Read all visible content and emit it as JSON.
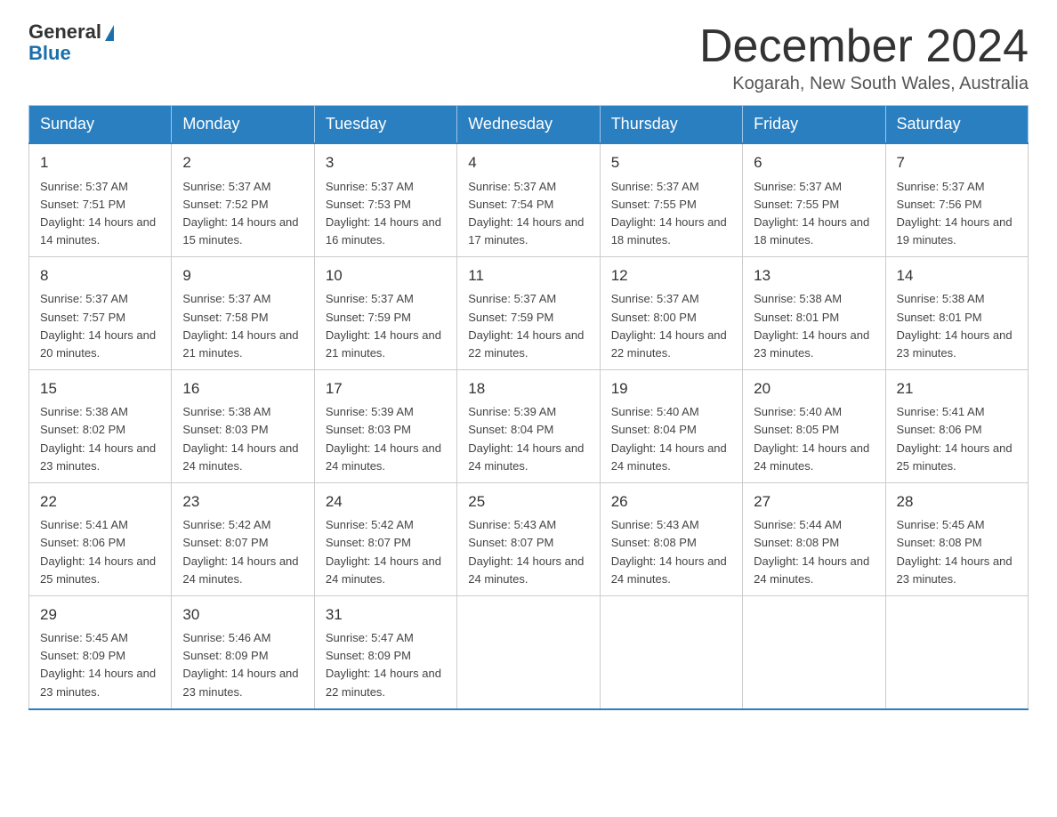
{
  "header": {
    "logo_general": "General",
    "logo_blue": "Blue",
    "month_title": "December 2024",
    "location": "Kogarah, New South Wales, Australia"
  },
  "days_of_week": [
    "Sunday",
    "Monday",
    "Tuesday",
    "Wednesday",
    "Thursday",
    "Friday",
    "Saturday"
  ],
  "weeks": [
    [
      {
        "day": "1",
        "sunrise": "5:37 AM",
        "sunset": "7:51 PM",
        "daylight": "14 hours and 14 minutes."
      },
      {
        "day": "2",
        "sunrise": "5:37 AM",
        "sunset": "7:52 PM",
        "daylight": "14 hours and 15 minutes."
      },
      {
        "day": "3",
        "sunrise": "5:37 AM",
        "sunset": "7:53 PM",
        "daylight": "14 hours and 16 minutes."
      },
      {
        "day": "4",
        "sunrise": "5:37 AM",
        "sunset": "7:54 PM",
        "daylight": "14 hours and 17 minutes."
      },
      {
        "day": "5",
        "sunrise": "5:37 AM",
        "sunset": "7:55 PM",
        "daylight": "14 hours and 18 minutes."
      },
      {
        "day": "6",
        "sunrise": "5:37 AM",
        "sunset": "7:55 PM",
        "daylight": "14 hours and 18 minutes."
      },
      {
        "day": "7",
        "sunrise": "5:37 AM",
        "sunset": "7:56 PM",
        "daylight": "14 hours and 19 minutes."
      }
    ],
    [
      {
        "day": "8",
        "sunrise": "5:37 AM",
        "sunset": "7:57 PM",
        "daylight": "14 hours and 20 minutes."
      },
      {
        "day": "9",
        "sunrise": "5:37 AM",
        "sunset": "7:58 PM",
        "daylight": "14 hours and 21 minutes."
      },
      {
        "day": "10",
        "sunrise": "5:37 AM",
        "sunset": "7:59 PM",
        "daylight": "14 hours and 21 minutes."
      },
      {
        "day": "11",
        "sunrise": "5:37 AM",
        "sunset": "7:59 PM",
        "daylight": "14 hours and 22 minutes."
      },
      {
        "day": "12",
        "sunrise": "5:37 AM",
        "sunset": "8:00 PM",
        "daylight": "14 hours and 22 minutes."
      },
      {
        "day": "13",
        "sunrise": "5:38 AM",
        "sunset": "8:01 PM",
        "daylight": "14 hours and 23 minutes."
      },
      {
        "day": "14",
        "sunrise": "5:38 AM",
        "sunset": "8:01 PM",
        "daylight": "14 hours and 23 minutes."
      }
    ],
    [
      {
        "day": "15",
        "sunrise": "5:38 AM",
        "sunset": "8:02 PM",
        "daylight": "14 hours and 23 minutes."
      },
      {
        "day": "16",
        "sunrise": "5:38 AM",
        "sunset": "8:03 PM",
        "daylight": "14 hours and 24 minutes."
      },
      {
        "day": "17",
        "sunrise": "5:39 AM",
        "sunset": "8:03 PM",
        "daylight": "14 hours and 24 minutes."
      },
      {
        "day": "18",
        "sunrise": "5:39 AM",
        "sunset": "8:04 PM",
        "daylight": "14 hours and 24 minutes."
      },
      {
        "day": "19",
        "sunrise": "5:40 AM",
        "sunset": "8:04 PM",
        "daylight": "14 hours and 24 minutes."
      },
      {
        "day": "20",
        "sunrise": "5:40 AM",
        "sunset": "8:05 PM",
        "daylight": "14 hours and 24 minutes."
      },
      {
        "day": "21",
        "sunrise": "5:41 AM",
        "sunset": "8:06 PM",
        "daylight": "14 hours and 25 minutes."
      }
    ],
    [
      {
        "day": "22",
        "sunrise": "5:41 AM",
        "sunset": "8:06 PM",
        "daylight": "14 hours and 25 minutes."
      },
      {
        "day": "23",
        "sunrise": "5:42 AM",
        "sunset": "8:07 PM",
        "daylight": "14 hours and 24 minutes."
      },
      {
        "day": "24",
        "sunrise": "5:42 AM",
        "sunset": "8:07 PM",
        "daylight": "14 hours and 24 minutes."
      },
      {
        "day": "25",
        "sunrise": "5:43 AM",
        "sunset": "8:07 PM",
        "daylight": "14 hours and 24 minutes."
      },
      {
        "day": "26",
        "sunrise": "5:43 AM",
        "sunset": "8:08 PM",
        "daylight": "14 hours and 24 minutes."
      },
      {
        "day": "27",
        "sunrise": "5:44 AM",
        "sunset": "8:08 PM",
        "daylight": "14 hours and 24 minutes."
      },
      {
        "day": "28",
        "sunrise": "5:45 AM",
        "sunset": "8:08 PM",
        "daylight": "14 hours and 23 minutes."
      }
    ],
    [
      {
        "day": "29",
        "sunrise": "5:45 AM",
        "sunset": "8:09 PM",
        "daylight": "14 hours and 23 minutes."
      },
      {
        "day": "30",
        "sunrise": "5:46 AM",
        "sunset": "8:09 PM",
        "daylight": "14 hours and 23 minutes."
      },
      {
        "day": "31",
        "sunrise": "5:47 AM",
        "sunset": "8:09 PM",
        "daylight": "14 hours and 22 minutes."
      },
      null,
      null,
      null,
      null
    ]
  ],
  "labels": {
    "sunrise": "Sunrise:",
    "sunset": "Sunset:",
    "daylight": "Daylight:"
  }
}
